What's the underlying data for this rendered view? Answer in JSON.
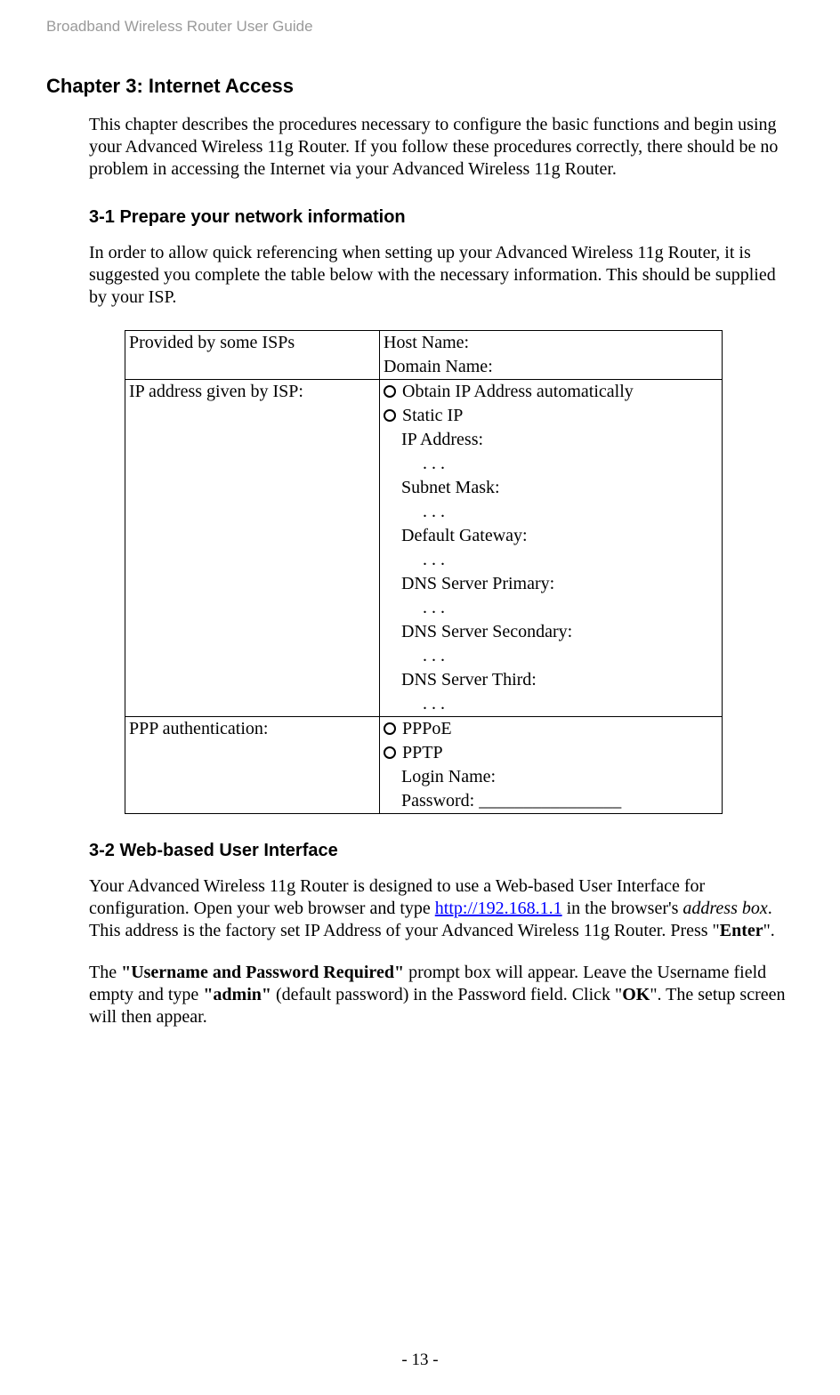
{
  "header": "Broadband Wireless Router User Guide",
  "chapter": {
    "title": "Chapter 3: Internet Access",
    "intro": "This chapter describes the procedures necessary to configure the basic functions and begin using your Advanced Wireless 11g Router. If you follow these procedures correctly, there should be no problem in accessing the Internet via your Advanced Wireless 11g Router."
  },
  "section31": {
    "title": "3-1 Prepare your network information",
    "para": "In order to allow quick referencing when setting up your Advanced Wireless 11g Router, it is suggested you complete the table below with the necessary information. This should be supplied by your ISP."
  },
  "table": {
    "row1": {
      "left": "Provided by some ISPs",
      "right_l1": "Host Name:",
      "right_l2": "Domain Name:"
    },
    "row2": {
      "left": "IP address given by ISP:",
      "opt1": "Obtain IP Address automatically",
      "opt2": "Static IP",
      "ipaddr": "IP Address:",
      "dots": "     .      .      .",
      "subnet": "Subnet Mask:",
      "gateway": "Default Gateway:",
      "dns1": "DNS Server Primary:",
      "dns2": "DNS Server Secondary:",
      "dns3": "DNS Server Third:"
    },
    "row3": {
      "left": "PPP authentication:",
      "opt1": "PPPoE",
      "opt2": "PPTP",
      "login": "Login Name:",
      "password": "Password: ________________"
    }
  },
  "section32": {
    "title": "3-2 Web-based User Interface",
    "para1_pre": "Your Advanced Wireless 11g Router is designed to use a Web-based User Interface for configuration. Open your web browser and type ",
    "link": "http://192.168.1.1",
    "para1_mid": " in the browser's ",
    "address_box": "address box",
    "para1_post": ". This address is the factory set IP Address of your Advanced Wireless 11g Router. Press \"",
    "enter": "Enter",
    "para1_end": "\".",
    "para2_pre": "The ",
    "prompt": "\"Username and Password Required\"",
    "para2_mid1": " prompt box will appear. Leave the Username field empty and type ",
    "admin": "\"admin\"",
    "para2_mid2": " (default password) in the Password field. Click \"",
    "ok": "OK",
    "para2_end": "\". The setup screen will then appear."
  },
  "footer": "- 13 -"
}
